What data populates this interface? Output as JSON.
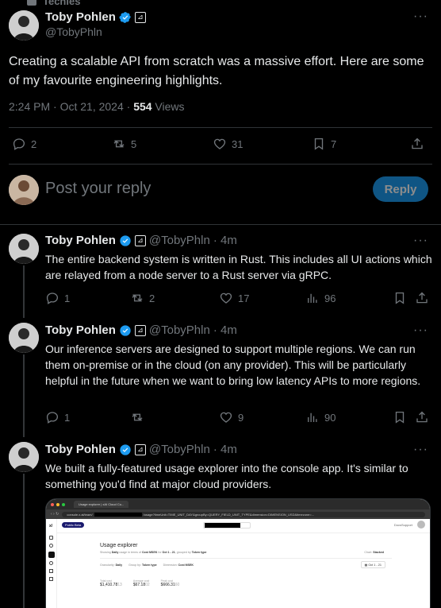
{
  "header": {
    "community_label": "Techies"
  },
  "main_tweet": {
    "name": "Toby Pohlen",
    "handle": "@TobyPhln",
    "text": "Creating a scalable API from scratch was a massive effort. Here are some of my favourite engineering highlights.",
    "time": "2:24 PM · Oct 21, 2024 · ",
    "views_count": "554",
    "views_label": " Views",
    "stats": {
      "replies": "2",
      "reposts": "5",
      "likes": "31",
      "bookmarks": "7"
    }
  },
  "composer": {
    "placeholder": "Post your reply",
    "button": "Reply"
  },
  "replies": [
    {
      "name": "Toby Pohlen",
      "handle": "@TobyPhln",
      "age": "· 4m",
      "text": "The entire backend system is written in Rust. This includes all UI actions which are relayed from a node server to a Rust server via gRPC.",
      "stats": {
        "replies": "1",
        "reposts": "2",
        "likes": "17",
        "views": "96"
      }
    },
    {
      "name": "Toby Pohlen",
      "handle": "@TobyPhln",
      "age": "· 4m",
      "text": "Our inference servers are designed to support multiple regions. We can run them on-premise or in the cloud (on any provider). This will be particularly helpful in the future when we want to bring low latency APIs to more regions.",
      "stats": {
        "replies": "1",
        "reposts": "",
        "likes": "9",
        "views": "90"
      }
    },
    {
      "name": "Toby Pohlen",
      "handle": "@TobyPhln",
      "age": "· 4m",
      "text": "We built a fully-featured usage explorer into the console app. It's similar to something you'd find at major cloud providers."
    }
  ],
  "screenshot": {
    "tab_title": "Usage explorer | xAI Cloud Co...",
    "url": "console.x.ai/team/",
    "url_tail": "/usage?timeUnit=TIME_UNIT_DAY&groupBy=QUERY_FIELD_UNIT_TYPE&dimension=DIMENSION_USD&timezone=...",
    "badge": "Public Beta",
    "docs": "Docs",
    "support": "Support",
    "title": "Usage explorer",
    "subtitle_pre": "Showing ",
    "subtitle_bold1": "Daily",
    "subtitle_mid1": " usage in terms of ",
    "subtitle_bold2": "Cost MSEK",
    "subtitle_mid2": " for ",
    "subtitle_bold3": "Oct 1 - 21",
    "subtitle_mid3": ", grouped by ",
    "subtitle_bold4": "Token type",
    "chart_label": "Chart: ",
    "chart_value": "Stacked",
    "granularity_label": "Granularity: ",
    "granularity_value": "Daily",
    "group_label": "Group by: ",
    "group_value": "Token type",
    "dimension_label": "Dimension: ",
    "dimension_value": "Cost MSEK",
    "date_range": "Oct 1 - 21",
    "kpis": [
      {
        "label": "Total cost",
        "value": "$1,410.78",
        "suffix": "13"
      },
      {
        "label": "Average cost",
        "value": "$67.18",
        "suffix": "02"
      },
      {
        "label": "Peak cost",
        "value": "$666.31",
        "suffix": "60"
      }
    ]
  },
  "colors": {
    "accent": "#1d9bf0",
    "verified": "#1d9bf0",
    "background": "#000000"
  }
}
